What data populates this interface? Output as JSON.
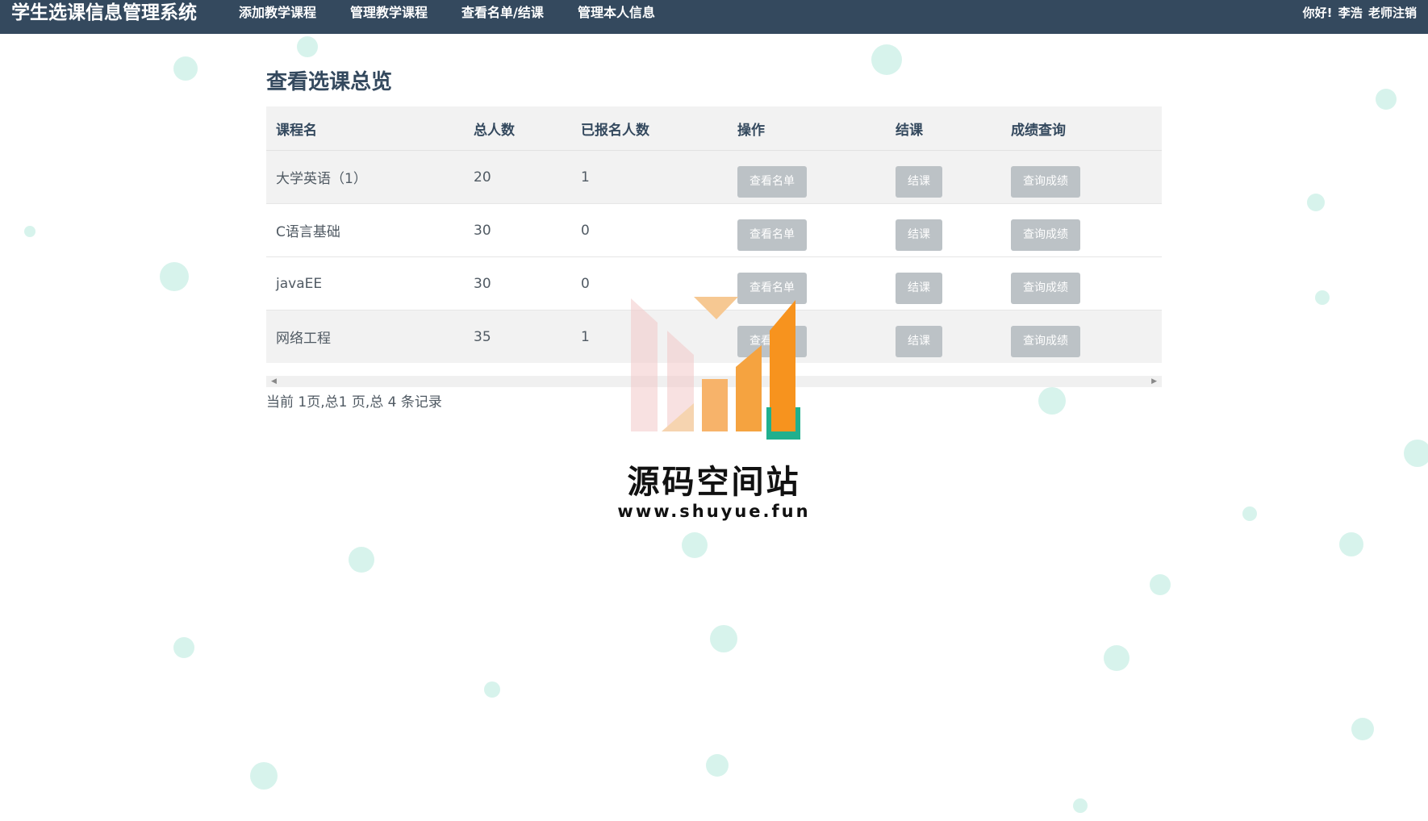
{
  "colors": {
    "navbar": "#34495e",
    "button": "#bcc2c6",
    "row_alt": "#f2f2f2",
    "bubble": "#c9efe6",
    "logo_orange": "#f7931e",
    "logo_teal": "#20b08e"
  },
  "navbar": {
    "brand": "学生选课信息管理系统",
    "items": [
      {
        "label": "添加教学课程"
      },
      {
        "label": "管理教学课程"
      },
      {
        "label": "查看名单/结课"
      },
      {
        "label": "管理本人信息"
      }
    ],
    "user": {
      "greeting": "你好!",
      "name": "李浩",
      "role_logout": "老师注销"
    }
  },
  "main": {
    "title": "查看选课总览",
    "table": {
      "headers": [
        "课程名",
        "总人数",
        "已报名人数",
        "操作",
        "结课",
        "成绩查询"
      ],
      "rows": [
        {
          "course": "大学英语（1）",
          "total": "20",
          "enrolled": "1"
        },
        {
          "course": "C语言基础",
          "total": "30",
          "enrolled": "0"
        },
        {
          "course": "javaEE",
          "total": "30",
          "enrolled": "0"
        },
        {
          "course": "网络工程",
          "total": "35",
          "enrolled": "1"
        }
      ],
      "row_buttons": {
        "view_list": "查看名单",
        "finish": "结课",
        "query_grades": "查询成绩"
      }
    },
    "pagination": "当前 1页,总1 页,总 4 条记录"
  },
  "watermark": {
    "title": "源码空间站",
    "url": "www.shuyue.fun"
  }
}
